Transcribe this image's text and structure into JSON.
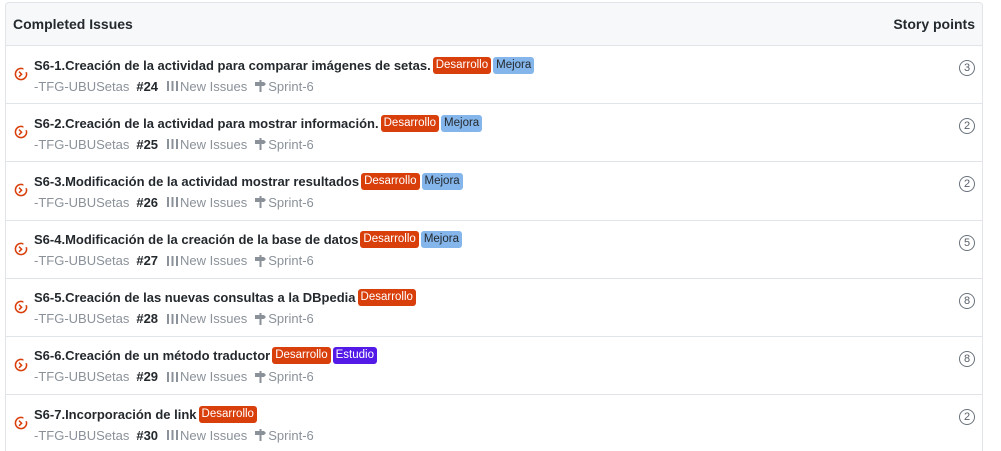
{
  "header": {
    "title": "Completed Issues",
    "points_label": "Story points"
  },
  "colors": {
    "Desarrollo": "#d93f0b",
    "Mejora": "#84b6eb",
    "Estudio": "#5319e7",
    "status_icon": "#d93f0b"
  },
  "icons": {
    "status": "closed-issue-icon",
    "project": "project-icon",
    "milestone": "milestone-icon"
  },
  "issues": [
    {
      "title": "S6-1.Creación de la actividad para comparar imágenes de setas.",
      "labels": [
        "Desarrollo",
        "Mejora"
      ],
      "repo": "-TFG-UBUSetas",
      "number": "#24",
      "project": "New Issues",
      "milestone": "Sprint-6",
      "points": "3"
    },
    {
      "title": "S6-2.Creación de la actividad para mostrar información.",
      "labels": [
        "Desarrollo",
        "Mejora"
      ],
      "repo": "-TFG-UBUSetas",
      "number": "#25",
      "project": "New Issues",
      "milestone": "Sprint-6",
      "points": "2"
    },
    {
      "title": "S6-3.Modificación de la actividad mostrar resultados",
      "labels": [
        "Desarrollo",
        "Mejora"
      ],
      "repo": "-TFG-UBUSetas",
      "number": "#26",
      "project": "New Issues",
      "milestone": "Sprint-6",
      "points": "2"
    },
    {
      "title": "S6-4.Modificación de la creación de la base de datos",
      "labels": [
        "Desarrollo",
        "Mejora"
      ],
      "repo": "-TFG-UBUSetas",
      "number": "#27",
      "project": "New Issues",
      "milestone": "Sprint-6",
      "points": "5"
    },
    {
      "title": "S6-5.Creación de las nuevas consultas a la DBpedia",
      "labels": [
        "Desarrollo"
      ],
      "repo": "-TFG-UBUSetas",
      "number": "#28",
      "project": "New Issues",
      "milestone": "Sprint-6",
      "points": "8"
    },
    {
      "title": "S6-6.Creación de un método traductor",
      "labels": [
        "Desarrollo",
        "Estudio"
      ],
      "repo": "-TFG-UBUSetas",
      "number": "#29",
      "project": "New Issues",
      "milestone": "Sprint-6",
      "points": "8"
    },
    {
      "title": "S6-7.Incorporación de link",
      "labels": [
        "Desarrollo"
      ],
      "repo": "-TFG-UBUSetas",
      "number": "#30",
      "project": "New Issues",
      "milestone": "Sprint-6",
      "points": "2"
    }
  ]
}
